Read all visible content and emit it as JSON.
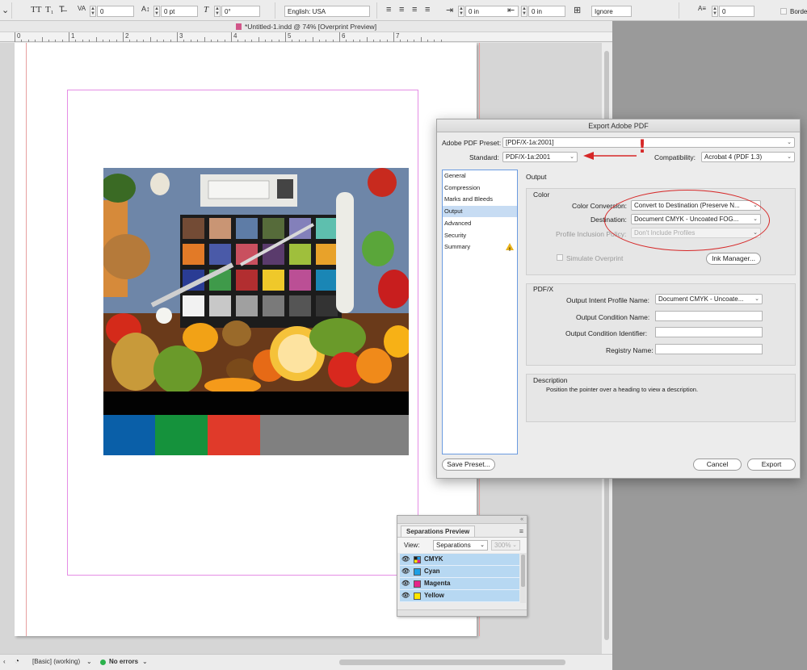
{
  "control_bar": {
    "tracking_value": "0",
    "baseline_shift_value": "0 pt",
    "skew_value": "0°",
    "language": "English: USA",
    "left_indent": "0 in",
    "right_indent": "0 in",
    "hyphen_mode": "Ignore",
    "column_value": "0",
    "border_label": "Border"
  },
  "document": {
    "tab_title": "*Untitled-1.indd @ 74% [Overprint Preview]",
    "ruler_labels": [
      "0",
      "1",
      "2",
      "3",
      "4",
      "5",
      "6",
      "7"
    ]
  },
  "status_bar": {
    "profile": "[Basic] (working)",
    "preflight": "No errors"
  },
  "separations_panel": {
    "title": "Separations Preview",
    "view_label": "View:",
    "view_value": "Separations",
    "zoom_value": "300%",
    "items": [
      {
        "name": "CMYK",
        "color": "#1e1e1e"
      },
      {
        "name": "Cyan",
        "color": "#1ea0e6"
      },
      {
        "name": "Magenta",
        "color": "#e6248a"
      },
      {
        "name": "Yellow",
        "color": "#ffe600"
      }
    ]
  },
  "dialog": {
    "title": "Export Adobe PDF",
    "preset_label": "Adobe PDF Preset:",
    "preset_value": "[PDF/X-1a:2001]",
    "standard_label": "Standard:",
    "standard_value": "PDF/X-1a:2001",
    "compat_label": "Compatibility:",
    "compat_value": "Acrobat 4 (PDF 1.3)",
    "nav": [
      "General",
      "Compression",
      "Marks and Bleeds",
      "Output",
      "Advanced",
      "Security",
      "Summary"
    ],
    "nav_selected": "Output",
    "section_title": "Output",
    "color_group": "Color",
    "color_conversion_label": "Color Conversion:",
    "color_conversion_value": "Convert to Destination (Preserve N...",
    "destination_label": "Destination:",
    "destination_value": "Document CMYK - Uncoated FOG...",
    "profile_inclusion_label": "Profile Inclusion Policy:",
    "profile_inclusion_value": "Don't Include Profiles",
    "simulate_overprint": "Simulate Overprint",
    "ink_manager": "Ink Manager...",
    "pdfx_group": "PDF/X",
    "output_intent_label": "Output Intent Profile Name:",
    "output_intent_value": "Document CMYK - Uncoate...",
    "output_condition_name_label": "Output Condition Name:",
    "output_condition_identifier_label": "Output Condition Identifier:",
    "registry_name_label": "Registry Name:",
    "description_group": "Description",
    "description_text": "Position the pointer over a heading to view a description.",
    "save_preset": "Save Preset...",
    "cancel": "Cancel",
    "export": "Export"
  },
  "annotation": {
    "exclaim": "!",
    "color": "#d62828"
  },
  "colors": {
    "swatch_blue": "#0a5fa8",
    "swatch_green": "#15923c",
    "swatch_red": "#e03a2a",
    "swatch_gray": "#808080"
  }
}
